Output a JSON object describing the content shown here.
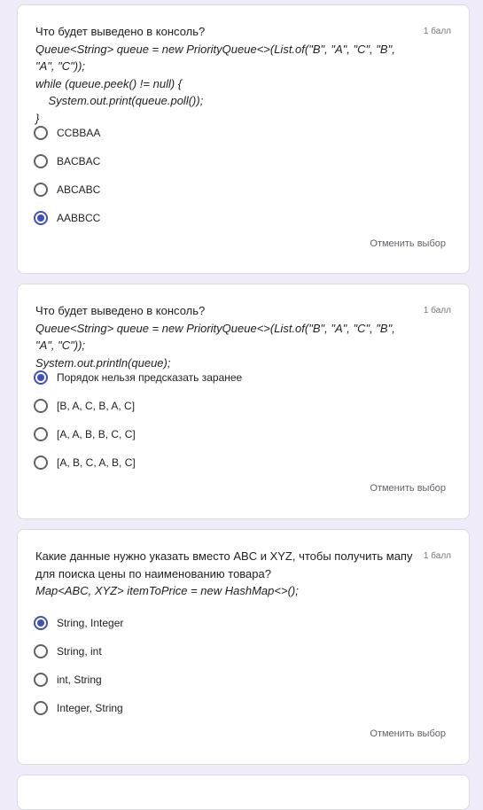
{
  "questions": [
    {
      "title": "Что будет выведено в консоль?",
      "code": [
        "Queue<String> queue = new PriorityQueue<>(List.of(\"B\", \"A\", \"C\", \"B\", \"A\", \"C\"));",
        "while (queue.peek() != null) {",
        "    System.out.print(queue.poll());",
        "}"
      ],
      "points": "1 балл",
      "options": [
        "CCBBAA",
        "BACBAC",
        "ABCABC",
        "AABBCC"
      ],
      "selected_index": 3,
      "clear_label": "Отменить выбор"
    },
    {
      "title": "Что будет выведено в консоль?",
      "code": [
        "Queue<String> queue = new PriorityQueue<>(List.of(\"B\", \"A\", \"C\", \"B\", \"A\", \"C\"));",
        "System.out.println(queue);"
      ],
      "points": "1 балл",
      "options": [
        "Порядок нельзя предсказать заранее",
        "[B, A, C, B, A, C]",
        "[A, A, B, B, C, C]",
        "[A, B, C, A, B, C]"
      ],
      "selected_index": 0,
      "clear_label": "Отменить выбор"
    },
    {
      "title_lines": [
        "Какие данные нужно указать вместо ABC и XYZ, чтобы получить мапу",
        "для поиска цены по наименованию товара?"
      ],
      "code": [
        "Map<ABC, XYZ> itemToPrice = new HashMap<>();"
      ],
      "points": "1 балл",
      "options": [
        "String, Integer",
        "String, int",
        "int, String",
        "Integer, String"
      ],
      "selected_index": 0,
      "clear_label": "Отменить выбор"
    }
  ]
}
